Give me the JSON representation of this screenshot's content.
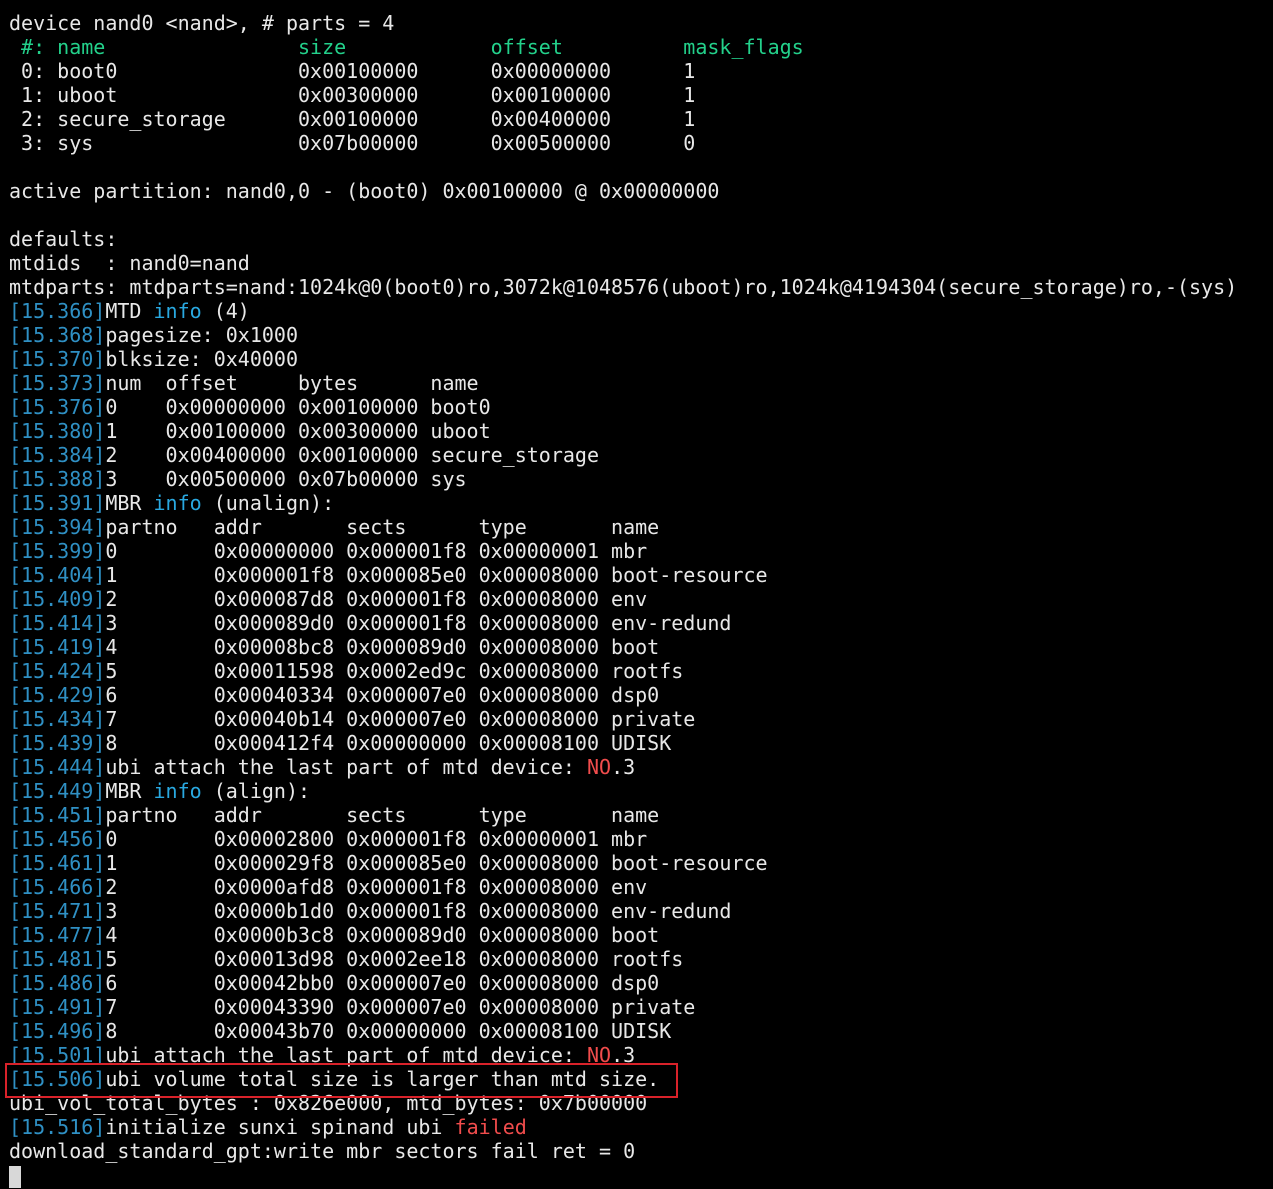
{
  "colors": {
    "background": "#000000",
    "text": "#e8e8e8",
    "header_green": "#23d18b",
    "timestamp_blue": "#2f90c4",
    "info_blue": "#29a8e0",
    "error_red": "#f14c4c",
    "highlight_box": "#d9222a"
  },
  "lines": [
    {
      "type": "text",
      "text": "device nand0 <nand>, # parts = 4"
    },
    {
      "type": "header",
      "text": " #: name                size            offset          mask_flags"
    },
    {
      "type": "text",
      "text": " 0: boot0               0x00100000      0x00000000      1"
    },
    {
      "type": "text",
      "text": " 1: uboot               0x00300000      0x00100000      1"
    },
    {
      "type": "text",
      "text": " 2: secure_storage      0x00100000      0x00400000      1"
    },
    {
      "type": "text",
      "text": " 3: sys                 0x07b00000      0x00500000      0"
    },
    {
      "type": "blank"
    },
    {
      "type": "text",
      "text": "active partition: nand0,0 - (boot0) 0x00100000 @ 0x00000000"
    },
    {
      "type": "blank"
    },
    {
      "type": "text",
      "text": "defaults:"
    },
    {
      "type": "text",
      "text": "mtdids  : nand0=nand"
    },
    {
      "type": "text",
      "text": "mtdparts: mtdparts=nand:1024k@0(boot0)ro,3072k@1048576(uboot)ro,1024k@4194304(secure_storage)ro,-(sys)"
    },
    {
      "type": "log",
      "ts": "[15.366]",
      "parts": [
        {
          "t": "MTD "
        },
        {
          "t": "info",
          "c": "info"
        },
        {
          "t": " (4)"
        }
      ]
    },
    {
      "type": "log",
      "ts": "[15.368]",
      "parts": [
        {
          "t": "pagesize: 0x1000"
        }
      ]
    },
    {
      "type": "log",
      "ts": "[15.370]",
      "parts": [
        {
          "t": "blksize: 0x40000"
        }
      ]
    },
    {
      "type": "log",
      "ts": "[15.373]",
      "parts": [
        {
          "t": "num  offset     bytes      name"
        }
      ]
    },
    {
      "type": "log",
      "ts": "[15.376]",
      "parts": [
        {
          "t": "0    0x00000000 0x00100000 boot0"
        }
      ]
    },
    {
      "type": "log",
      "ts": "[15.380]",
      "parts": [
        {
          "t": "1    0x00100000 0x00300000 uboot"
        }
      ]
    },
    {
      "type": "log",
      "ts": "[15.384]",
      "parts": [
        {
          "t": "2    0x00400000 0x00100000 secure_storage"
        }
      ]
    },
    {
      "type": "log",
      "ts": "[15.388]",
      "parts": [
        {
          "t": "3    0x00500000 0x07b00000 sys"
        }
      ]
    },
    {
      "type": "log",
      "ts": "[15.391]",
      "parts": [
        {
          "t": "MBR "
        },
        {
          "t": "info",
          "c": "info"
        },
        {
          "t": " (unalign):"
        }
      ]
    },
    {
      "type": "log",
      "ts": "[15.394]",
      "parts": [
        {
          "t": "partno   addr       sects      type       name"
        }
      ]
    },
    {
      "type": "log",
      "ts": "[15.399]",
      "parts": [
        {
          "t": "0        0x00000000 0x000001f8 0x00000001 mbr"
        }
      ]
    },
    {
      "type": "log",
      "ts": "[15.404]",
      "parts": [
        {
          "t": "1        0x000001f8 0x000085e0 0x00008000 boot-resource"
        }
      ]
    },
    {
      "type": "log",
      "ts": "[15.409]",
      "parts": [
        {
          "t": "2        0x000087d8 0x000001f8 0x00008000 env"
        }
      ]
    },
    {
      "type": "log",
      "ts": "[15.414]",
      "parts": [
        {
          "t": "3        0x000089d0 0x000001f8 0x00008000 env-redund"
        }
      ]
    },
    {
      "type": "log",
      "ts": "[15.419]",
      "parts": [
        {
          "t": "4        0x00008bc8 0x000089d0 0x00008000 boot"
        }
      ]
    },
    {
      "type": "log",
      "ts": "[15.424]",
      "parts": [
        {
          "t": "5        0x00011598 0x0002ed9c 0x00008000 rootfs"
        }
      ]
    },
    {
      "type": "log",
      "ts": "[15.429]",
      "parts": [
        {
          "t": "6        0x00040334 0x000007e0 0x00008000 dsp0"
        }
      ]
    },
    {
      "type": "log",
      "ts": "[15.434]",
      "parts": [
        {
          "t": "7        0x00040b14 0x000007e0 0x00008000 private"
        }
      ]
    },
    {
      "type": "log",
      "ts": "[15.439]",
      "parts": [
        {
          "t": "8        0x000412f4 0x00000000 0x00008100 UDISK"
        }
      ]
    },
    {
      "type": "log",
      "ts": "[15.444]",
      "parts": [
        {
          "t": "ubi attach the last part of mtd device: "
        },
        {
          "t": "NO",
          "c": "red"
        },
        {
          "t": ".3"
        }
      ]
    },
    {
      "type": "log",
      "ts": "[15.449]",
      "parts": [
        {
          "t": "MBR "
        },
        {
          "t": "info",
          "c": "info"
        },
        {
          "t": " (align):"
        }
      ]
    },
    {
      "type": "log",
      "ts": "[15.451]",
      "parts": [
        {
          "t": "partno   addr       sects      type       name"
        }
      ]
    },
    {
      "type": "log",
      "ts": "[15.456]",
      "parts": [
        {
          "t": "0        0x00002800 0x000001f8 0x00000001 mbr"
        }
      ]
    },
    {
      "type": "log",
      "ts": "[15.461]",
      "parts": [
        {
          "t": "1        0x000029f8 0x000085e0 0x00008000 boot-resource"
        }
      ]
    },
    {
      "type": "log",
      "ts": "[15.466]",
      "parts": [
        {
          "t": "2        0x0000afd8 0x000001f8 0x00008000 env"
        }
      ]
    },
    {
      "type": "log",
      "ts": "[15.471]",
      "parts": [
        {
          "t": "3        0x0000b1d0 0x000001f8 0x00008000 env-redund"
        }
      ]
    },
    {
      "type": "log",
      "ts": "[15.477]",
      "parts": [
        {
          "t": "4        0x0000b3c8 0x000089d0 0x00008000 boot"
        }
      ]
    },
    {
      "type": "log",
      "ts": "[15.481]",
      "parts": [
        {
          "t": "5        0x00013d98 0x0002ee18 0x00008000 rootfs"
        }
      ]
    },
    {
      "type": "log",
      "ts": "[15.486]",
      "parts": [
        {
          "t": "6        0x00042bb0 0x000007e0 0x00008000 dsp0"
        }
      ]
    },
    {
      "type": "log",
      "ts": "[15.491]",
      "parts": [
        {
          "t": "7        0x00043390 0x000007e0 0x00008000 private"
        }
      ]
    },
    {
      "type": "log",
      "ts": "[15.496]",
      "parts": [
        {
          "t": "8        0x00043b70 0x00000000 0x00008100 UDISK"
        }
      ]
    },
    {
      "type": "log",
      "ts": "[15.501]",
      "parts": [
        {
          "t": "ubi attach the last part of mtd device: "
        },
        {
          "t": "NO",
          "c": "red"
        },
        {
          "t": ".3"
        }
      ]
    },
    {
      "type": "log",
      "ts": "[15.506]",
      "parts": [
        {
          "t": "ubi volume total size is larger than mtd size."
        }
      ]
    },
    {
      "type": "text",
      "text": "ubi_vol_total_bytes : 0x826e000, mtd_bytes: 0x7b00000"
    },
    {
      "type": "log",
      "ts": "[15.516]",
      "parts": [
        {
          "t": "initialize sunxi spinand ubi "
        },
        {
          "t": "failed",
          "c": "red"
        }
      ]
    },
    {
      "type": "text",
      "text": "download_standard_gpt:write mbr sectors fail ret = 0"
    },
    {
      "type": "cursor"
    }
  ]
}
